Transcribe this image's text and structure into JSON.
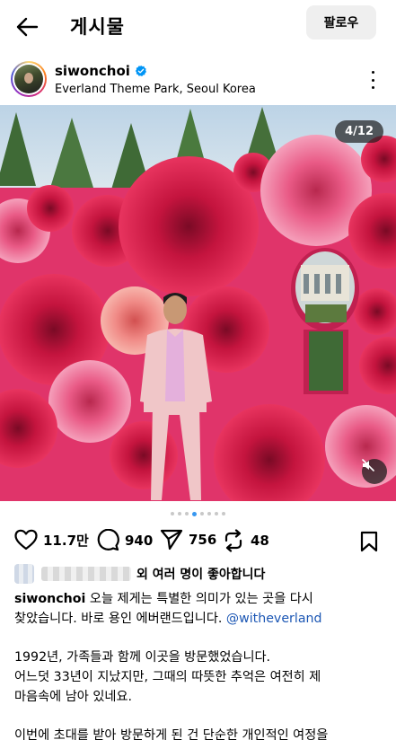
{
  "header": {
    "title": "게시물",
    "follow_label": "팔로우"
  },
  "post": {
    "username": "siwonchoi",
    "location": "Everland Theme Park, Seoul Korea",
    "counter": "4/12"
  },
  "actions": {
    "likes_count": "11.7만",
    "comments_count": "940",
    "shares_count": "756",
    "reposts_count": "48"
  },
  "likes": {
    "text": "외 여러 명이 좋아합니다"
  },
  "caption": {
    "username": "siwonchoi",
    "line1": "오늘 제게는 특별한 의미가 있는 곳을 다시",
    "line2": "찾았습니다. 바로 용인 에버랜드입니다.",
    "mention": "@witheverland",
    "para2_line1": "1992년, 가족들과 함께 이곳을 방문했었습니다.",
    "para2_line2": "어느덧 33년이 지났지만, 그때의 따뜻한 추억은 여전히 제",
    "para2_line3": "마음속에 남아 있네요.",
    "para3_line1": "이번에 초대를 받아 방문하게 된 건 단순한 개인적인 여정을"
  },
  "carousel": {
    "total": 8,
    "active_index": 3
  },
  "colors": {
    "mention": "#1c57b4",
    "active_dot": "#3897f0",
    "rose_wall": "#d81b5c"
  },
  "icons": [
    "back-arrow-icon",
    "verified-badge-icon",
    "more-options-icon",
    "heart-icon",
    "comment-icon",
    "share-icon",
    "repost-icon",
    "bookmark-icon",
    "mute-icon"
  ]
}
